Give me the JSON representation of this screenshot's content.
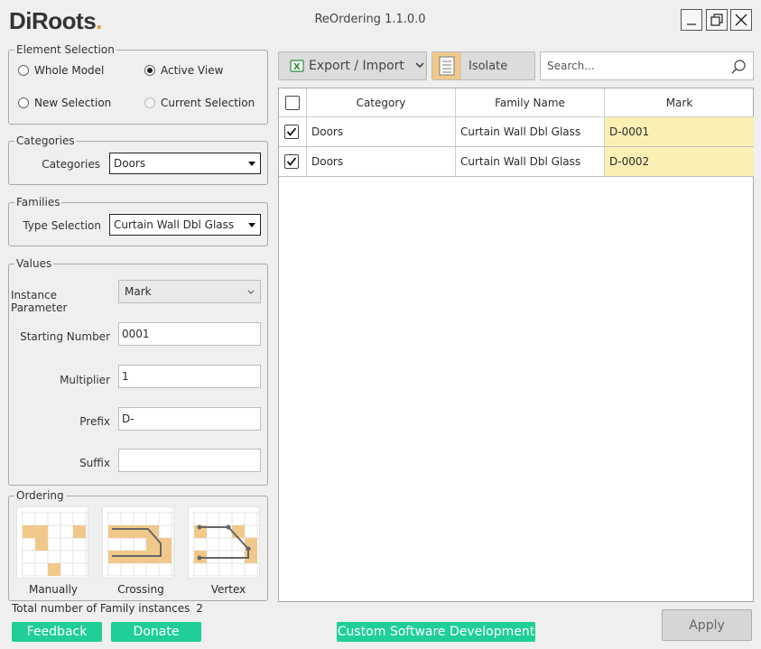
{
  "app": {
    "logo_main": "DiRoots",
    "logo_dot": ".",
    "title": "ReOrdering 1.1.0.0"
  },
  "element_selection": {
    "legend": "Element Selection",
    "options": [
      "Whole Model",
      "Active View",
      "New Selection",
      "Current Selection"
    ],
    "selected": "Active View"
  },
  "categories": {
    "legend": "Categories",
    "label": "Categories",
    "value": "Doors"
  },
  "families": {
    "legend": "Families",
    "label": "Type Selection",
    "value": "Curtain Wall Dbl Glass"
  },
  "values": {
    "legend": "Values",
    "instance_label": "Instance Parameter",
    "instance_value": "Mark",
    "start_label": "Starting Number",
    "start_value": "0001",
    "mult_label": "Multiplier",
    "mult_value": "1",
    "prefix_label": "Prefix",
    "prefix_value": "D-",
    "suffix_label": "Suffix",
    "suffix_value": ""
  },
  "ordering": {
    "legend": "Ordering",
    "options": [
      "Manually",
      "Crossing",
      "Vertex"
    ]
  },
  "total": {
    "label": "Total number of Family instances",
    "count": "2"
  },
  "toolbar": {
    "export_label": "Export / Import",
    "isolate_label": "Isolate",
    "search_placeholder": "Search..."
  },
  "table": {
    "columns": [
      "Category",
      "Family Name",
      "Mark"
    ],
    "rows": [
      {
        "checked": true,
        "category": "Doors",
        "family": "Curtain Wall Dbl Glass",
        "mark": "D-0001"
      },
      {
        "checked": true,
        "category": "Doors",
        "family": "Curtain Wall Dbl Glass",
        "mark": "D-0002"
      }
    ]
  },
  "footer": {
    "feedback": "Feedback",
    "donate": "Donate",
    "custom": "Custom Software Development",
    "apply": "Apply"
  },
  "colors": {
    "accent_green": "#1fcf97",
    "mark_highlight": "#fbf0b4",
    "order_tile": "#f0c98a",
    "logo_dot": "#e8a13c"
  }
}
